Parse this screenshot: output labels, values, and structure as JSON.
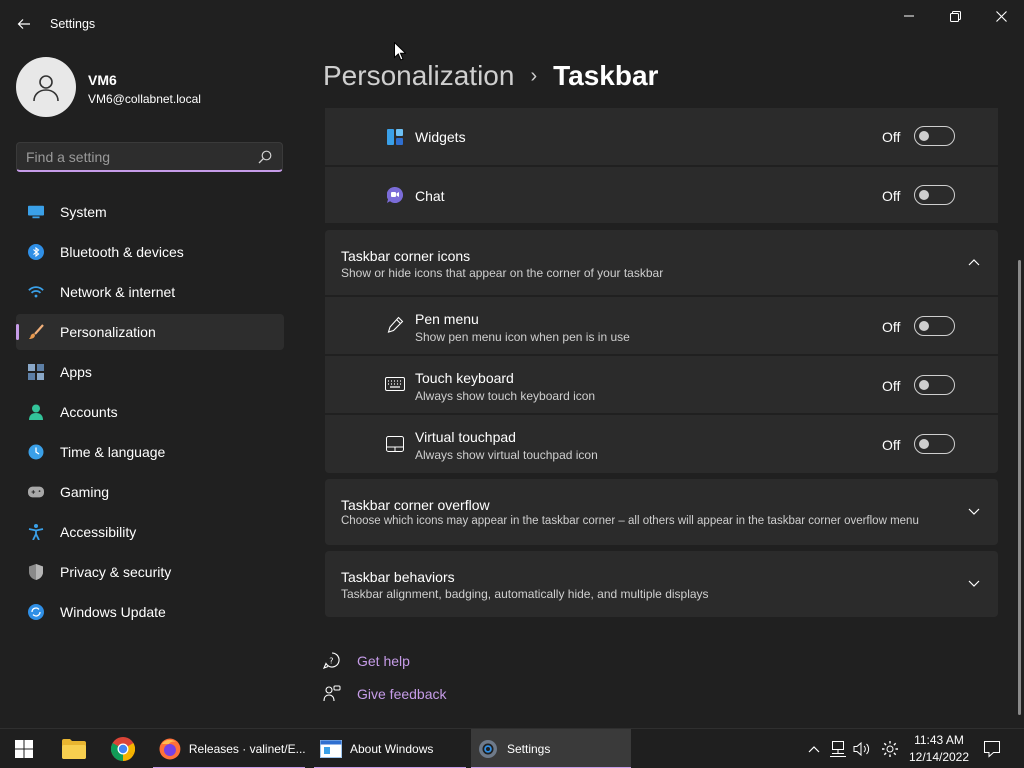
{
  "window": {
    "title": "Settings"
  },
  "profile": {
    "name": "VM6",
    "email": "VM6@collabnet.local"
  },
  "search": {
    "placeholder": "Find a setting"
  },
  "nav": {
    "items": [
      {
        "label": "System",
        "icon": "monitor-icon"
      },
      {
        "label": "Bluetooth & devices",
        "icon": "bluetooth-icon"
      },
      {
        "label": "Network & internet",
        "icon": "wifi-icon"
      },
      {
        "label": "Personalization",
        "icon": "brush-icon",
        "active": true
      },
      {
        "label": "Apps",
        "icon": "apps-icon"
      },
      {
        "label": "Accounts",
        "icon": "person-icon"
      },
      {
        "label": "Time & language",
        "icon": "clock-globe-icon"
      },
      {
        "label": "Gaming",
        "icon": "gamepad-icon"
      },
      {
        "label": "Accessibility",
        "icon": "accessibility-icon"
      },
      {
        "label": "Privacy & security",
        "icon": "shield-icon"
      },
      {
        "label": "Windows Update",
        "icon": "update-icon"
      }
    ]
  },
  "header": {
    "parent": "Personalization",
    "separator": "›",
    "current": "Taskbar"
  },
  "taskbar_items": {
    "widgets": {
      "label": "Widgets",
      "state": "Off"
    },
    "chat": {
      "label": "Chat",
      "state": "Off"
    }
  },
  "corner_icons": {
    "title": "Taskbar corner icons",
    "subtitle": "Show or hide icons that appear on the corner of your taskbar",
    "items": [
      {
        "label": "Pen menu",
        "sub": "Show pen menu icon when pen is in use",
        "state": "Off",
        "icon": "pen-icon"
      },
      {
        "label": "Touch keyboard",
        "sub": "Always show touch keyboard icon",
        "state": "Off",
        "icon": "keyboard-icon"
      },
      {
        "label": "Virtual touchpad",
        "sub": "Always show virtual touchpad icon",
        "state": "Off",
        "icon": "touchpad-icon"
      }
    ]
  },
  "corner_overflow": {
    "title": "Taskbar corner overflow",
    "subtitle": "Choose which icons may appear in the taskbar corner – all others will appear in the taskbar corner overflow menu"
  },
  "behaviors": {
    "title": "Taskbar behaviors",
    "subtitle": "Taskbar alignment, badging, automatically hide, and multiple displays"
  },
  "footer": {
    "help": "Get help",
    "feedback": "Give feedback"
  },
  "os_taskbar": {
    "firefox": "Releases · valinet/E...",
    "about": "About Windows",
    "settings": "Settings",
    "time": "11:43 AM",
    "date": "12/14/2022"
  },
  "colors": {
    "accent": "#c69ce8",
    "background": "#202020",
    "card": "#2b2b2b"
  }
}
